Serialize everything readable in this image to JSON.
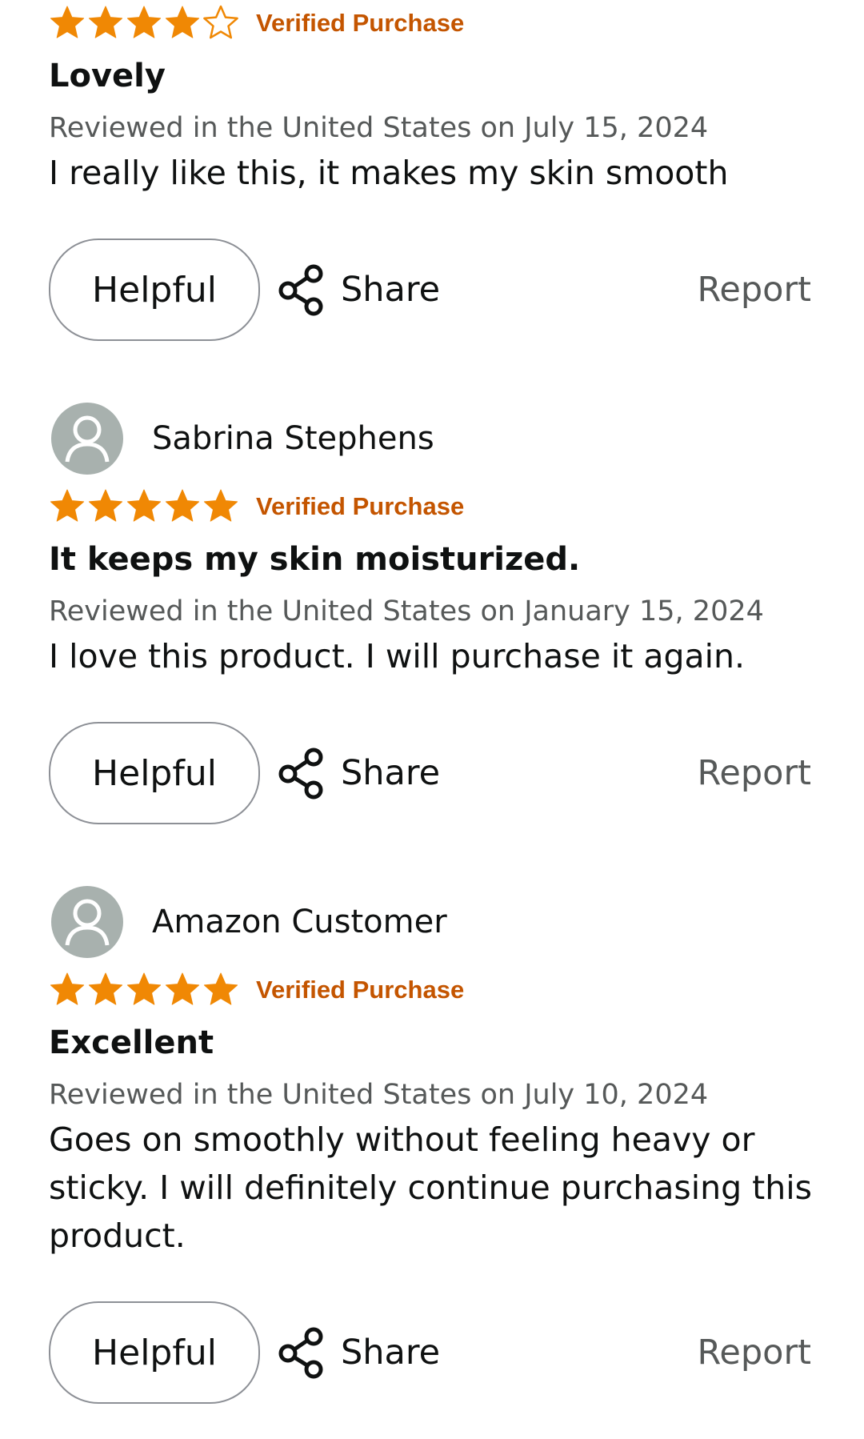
{
  "colors": {
    "star": "#f08804",
    "verified": "#c45500",
    "muted_text": "#565959",
    "avatar_bg": "#a8b1ae"
  },
  "reviews": [
    {
      "reviewer": "",
      "rating": 4,
      "max_rating": 5,
      "verified_label": "Verified Purchase",
      "title": "Lovely",
      "date": "Reviewed in the United States on July 15, 2024",
      "body": "I really like this, it makes my skin smooth",
      "helpful_label": "Helpful",
      "share_label": "Share",
      "report_label": "Report"
    },
    {
      "reviewer": "Sabrina Stephens",
      "rating": 5,
      "max_rating": 5,
      "verified_label": "Verified Purchase",
      "title": "It keeps my skin moisturized.",
      "date": "Reviewed in the United States on January 15, 2024",
      "body": "I love this product. I will purchase it again.",
      "helpful_label": "Helpful",
      "share_label": "Share",
      "report_label": "Report"
    },
    {
      "reviewer": "Amazon Customer",
      "rating": 5,
      "max_rating": 5,
      "verified_label": "Verified Purchase",
      "title": "Excellent",
      "date": "Reviewed in the United States on July 10, 2024",
      "body": "Goes on smoothly without feeling heavy or sticky. I will definitely continue purchasing this product.",
      "helpful_label": "Helpful",
      "share_label": "Share",
      "report_label": "Report"
    }
  ]
}
